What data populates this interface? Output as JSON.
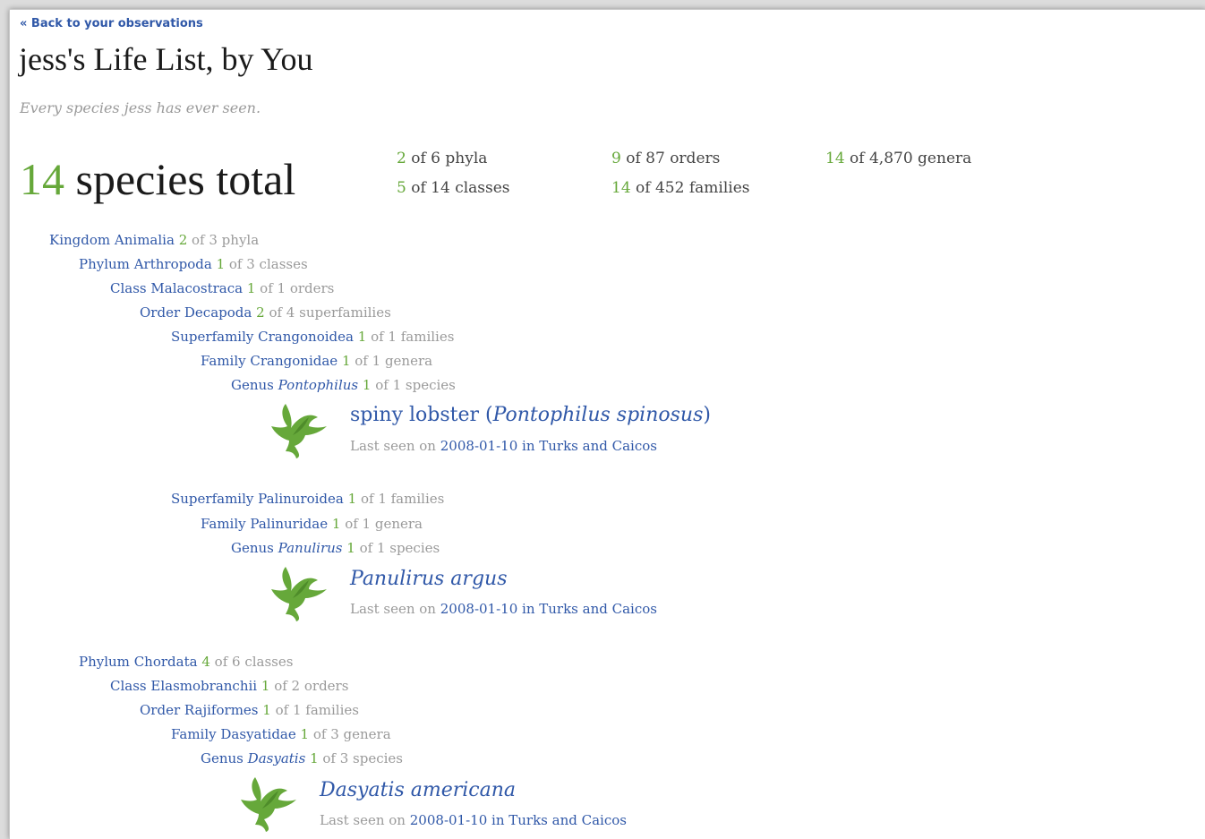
{
  "header": {
    "back_link": "« Back to your observations",
    "title": "jess's Life List, by You",
    "subtitle": "Every species jess has ever seen."
  },
  "summary": {
    "total_count": "14",
    "total_label": "species total",
    "stats": [
      {
        "count": "2",
        "text": "of 6 phyla"
      },
      {
        "count": "5",
        "text": "of 14 classes"
      },
      {
        "count": "9",
        "text": "of 87 orders"
      },
      {
        "count": "14",
        "text": "of 452 families"
      },
      {
        "count": "14",
        "text": "of 4,870 genera"
      }
    ]
  },
  "taxa": [
    {
      "rank": "Kingdom",
      "name": "Animalia",
      "count": "2",
      "of": "of 3 phyla"
    },
    {
      "rank": "Phylum",
      "name": "Arthropoda",
      "count": "1",
      "of": "of 3 classes"
    },
    {
      "rank": "Class",
      "name": "Malacostraca",
      "count": "1",
      "of": "of 1 orders"
    },
    {
      "rank": "Order",
      "name": "Decapoda",
      "count": "2",
      "of": "of 4 superfamilies"
    },
    {
      "rank": "Superfamily",
      "name": "Crangonoidea",
      "count": "1",
      "of": "of 1 families"
    },
    {
      "rank": "Family",
      "name": "Crangonidae",
      "count": "1",
      "of": "of 1 genera"
    },
    {
      "rank": "Genus",
      "name": "Pontophilus",
      "count": "1",
      "of": "of 1 species"
    },
    {
      "rank": "Superfamily",
      "name": "Palinuroidea",
      "count": "1",
      "of": "of 1 families"
    },
    {
      "rank": "Family",
      "name": "Palinuridae",
      "count": "1",
      "of": "of 1 genera"
    },
    {
      "rank": "Genus",
      "name": "Panulirus",
      "count": "1",
      "of": "of 1 species"
    },
    {
      "rank": "Phylum",
      "name": "Chordata",
      "count": "4",
      "of": "of 6 classes"
    },
    {
      "rank": "Class",
      "name": "Elasmobranchii",
      "count": "1",
      "of": "of 2 orders"
    },
    {
      "rank": "Order",
      "name": "Rajiformes",
      "count": "1",
      "of": "of 1 families"
    },
    {
      "rank": "Family",
      "name": "Dasyatidae",
      "count": "1",
      "of": "of 3 genera"
    },
    {
      "rank": "Genus",
      "name": "Dasyatis",
      "count": "1",
      "of": "of 3 species"
    }
  ],
  "species": [
    {
      "common": "spiny lobster",
      "open": " (",
      "scientific": "Pontophilus spinosus",
      "close": ")",
      "seen_label": "Last seen on",
      "seen_value": "2008-01-10 in Turks and Caicos",
      "icon": "bird-icon",
      "color": "#66a83a"
    },
    {
      "common": "",
      "open": "",
      "scientific": "Panulirus argus",
      "close": "",
      "seen_label": "Last seen on",
      "seen_value": "2008-01-10 in Turks and Caicos",
      "icon": "bird-icon",
      "color": "#66a83a"
    },
    {
      "common": "",
      "open": "",
      "scientific": "Dasyatis americana",
      "close": "",
      "seen_label": "Last seen on",
      "seen_value": "2008-01-10 in Turks and Caicos",
      "icon": "bird-icon",
      "color": "#66a83a"
    }
  ],
  "colors": {
    "link": "#3058a8",
    "accent_green": "#66a83a",
    "muted": "#9a9a9a"
  }
}
